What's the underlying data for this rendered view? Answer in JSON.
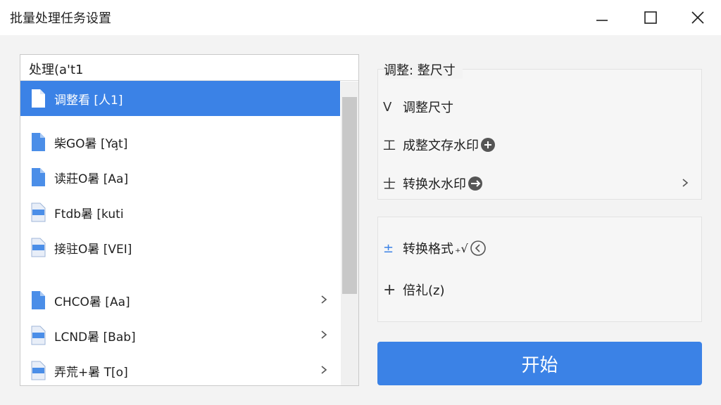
{
  "window": {
    "title": "批量处理任务设置"
  },
  "list": {
    "header": "处理(a't1",
    "items": [
      {
        "label": "调整看 [人1]",
        "selected": true,
        "icon": "file-icon"
      },
      {
        "label": "柴GO暑 [Ya̧t]",
        "icon": "document-icon"
      },
      {
        "label": "读莊O暑 [Aa]",
        "icon": "document-icon"
      },
      {
        "label": "Ftdb暑 [kuti",
        "icon": "image-doc-icon"
      },
      {
        "label": "接驻O暑 [VEI]",
        "icon": "image-doc-icon"
      },
      {
        "label": "CHCO暑 [Aa]",
        "icon": "document-icon",
        "chevron": true
      },
      {
        "label": "LCND暑 [Bab]",
        "icon": "image-doc-icon",
        "chevron": true
      },
      {
        "label": "弄荒+暑 T[o]",
        "icon": "image-doc-icon",
        "chevron": true
      }
    ]
  },
  "options": {
    "group1_title": "调整: 整尺寸",
    "resize": "调整尺寸",
    "add_watermark": "成整文存水印",
    "convert_watermark": "转换水水印",
    "convert_format": "转换格式",
    "format_suffix": "₊√",
    "rename": "倍礼(z)"
  },
  "start_button": "开始",
  "colors": {
    "accent": "#3b82e6",
    "selected_row": "#3b82e6"
  }
}
